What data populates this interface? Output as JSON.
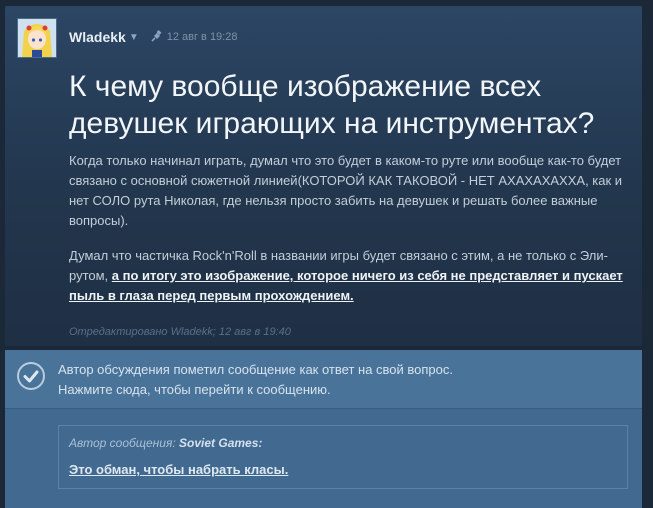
{
  "post": {
    "author": "Wladekk",
    "date": "12 авг в 19:28",
    "title": "К чему вообще изображение всех девушек играющих на инструментах?",
    "paragraph1": "Когда только начинал играть, думал что это будет в каком-то руте или вообще как-то будет связано с основной сюжетной линией(КОТОРОЙ КАК ТАКОВОЙ - НЕТ АХАХАХАХХА, как и нет СОЛО рута Николая, где нельзя просто забить на девушек и решать более важные вопросы).",
    "paragraph2_plain": "Думал что частичка Rock'n'Roll в названии игры будет связано с этим, а не только с Эли-рутом, ",
    "paragraph2_highlight": "а по итогу это изображение, которое ничего из себя не представляет и пускает пыль в глаза перед первым прохождением.",
    "edited_prefix": "Отредактировано",
    "edited_author": "Wladekk",
    "edited_date": "; 12 авг в 19:40"
  },
  "answer": {
    "line1": "Автор обсуждения пометил сообщение как ответ на свой вопрос.",
    "line2": "Нажмите сюда, чтобы перейти к сообщению.",
    "quote_label": "Автор сообщения: ",
    "quote_author": "Soviet Games",
    "quote_colon": ":",
    "quote_text": "Это обман, чтобы набрать класы."
  },
  "icons": {
    "pin": "pin-icon",
    "check": "checkmark-circle-icon",
    "caret": "caret-down-icon"
  },
  "colors": {
    "background": "#1b2838",
    "post": "#2c4664",
    "answer": "#4a7399"
  }
}
